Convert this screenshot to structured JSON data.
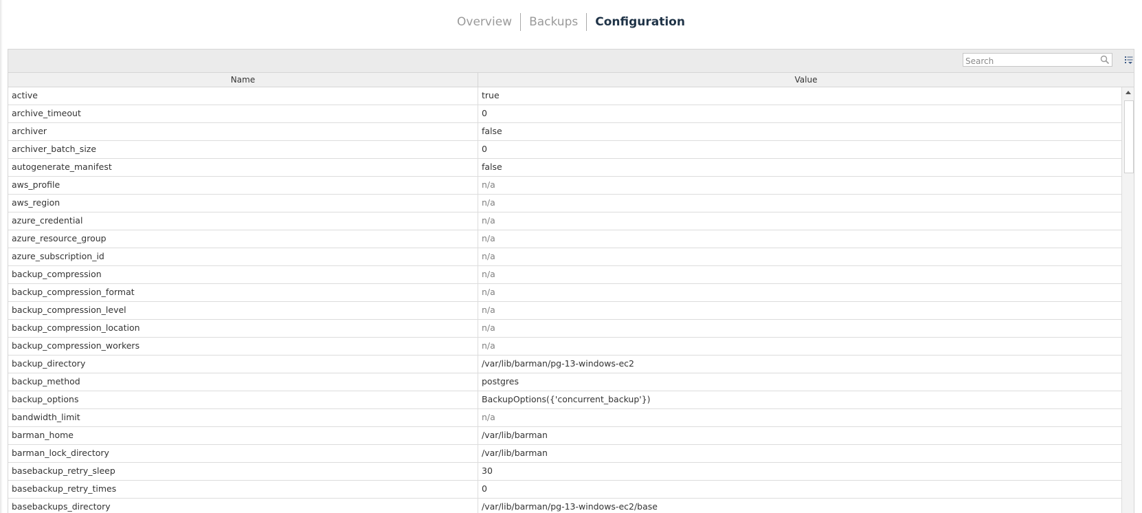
{
  "tabs": [
    {
      "label": "Overview",
      "active": false
    },
    {
      "label": "Backups",
      "active": false
    },
    {
      "label": "Configuration",
      "active": true
    }
  ],
  "toolbar": {
    "search_placeholder": "Search",
    "search_icon": "search-icon",
    "column_menu_icon": "column-menu-icon"
  },
  "table": {
    "columns": [
      "Name",
      "Value"
    ],
    "rows": [
      {
        "name": "active",
        "value": "true"
      },
      {
        "name": "archive_timeout",
        "value": "0"
      },
      {
        "name": "archiver",
        "value": "false"
      },
      {
        "name": "archiver_batch_size",
        "value": "0"
      },
      {
        "name": "autogenerate_manifest",
        "value": "false"
      },
      {
        "name": "aws_profile",
        "value": "n/a"
      },
      {
        "name": "aws_region",
        "value": "n/a"
      },
      {
        "name": "azure_credential",
        "value": "n/a"
      },
      {
        "name": "azure_resource_group",
        "value": "n/a"
      },
      {
        "name": "azure_subscription_id",
        "value": "n/a"
      },
      {
        "name": "backup_compression",
        "value": "n/a"
      },
      {
        "name": "backup_compression_format",
        "value": "n/a"
      },
      {
        "name": "backup_compression_level",
        "value": "n/a"
      },
      {
        "name": "backup_compression_location",
        "value": "n/a"
      },
      {
        "name": "backup_compression_workers",
        "value": "n/a"
      },
      {
        "name": "backup_directory",
        "value": "/var/lib/barman/pg-13-windows-ec2"
      },
      {
        "name": "backup_method",
        "value": "postgres"
      },
      {
        "name": "backup_options",
        "value": "BackupOptions({'concurrent_backup'})"
      },
      {
        "name": "bandwidth_limit",
        "value": "n/a"
      },
      {
        "name": "barman_home",
        "value": "/var/lib/barman"
      },
      {
        "name": "barman_lock_directory",
        "value": "/var/lib/barman"
      },
      {
        "name": "basebackup_retry_sleep",
        "value": "30"
      },
      {
        "name": "basebackup_retry_times",
        "value": "0"
      },
      {
        "name": "basebackups_directory",
        "value": "/var/lib/barman/pg-13-windows-ec2/base"
      }
    ]
  },
  "colors": {
    "active_tab": "#1f3347",
    "inactive_tab": "#9a9a9a",
    "toolbar_bg": "#ebebeb",
    "na_text": "#808080"
  }
}
